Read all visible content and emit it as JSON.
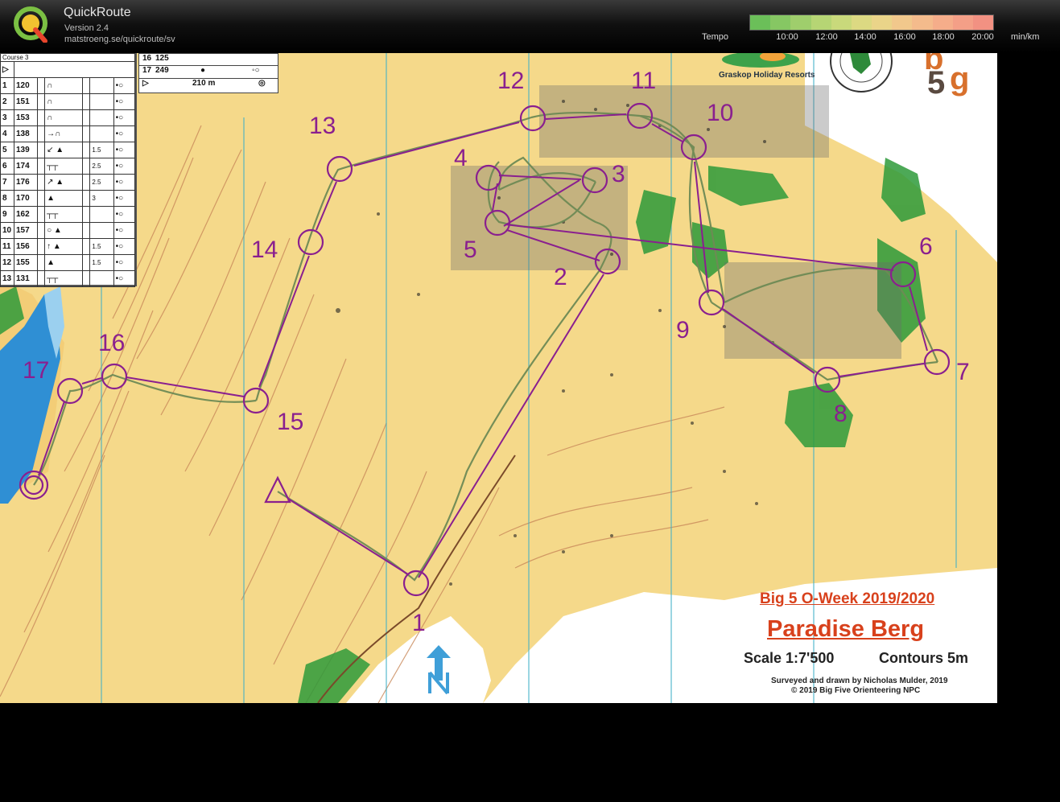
{
  "app": {
    "title": "QuickRoute",
    "version": "Version 2.4",
    "url": "matstroeng.se/quickroute/sv"
  },
  "tempo": {
    "label": "Tempo",
    "ticks": [
      "10:00",
      "12:00",
      "14:00",
      "16:00",
      "18:00",
      "20:00"
    ],
    "unit": "min/km",
    "colors": [
      "#6bbf59",
      "#86c763",
      "#9fce6c",
      "#b6d574",
      "#c9d97b",
      "#dcd982",
      "#ead489",
      "#f1c88c",
      "#f4bb8c",
      "#f5ad8a",
      "#f49f87",
      "#f29182"
    ]
  },
  "colors": {
    "course": "#8a1f8f",
    "route": "#6e8a55",
    "water": "#2f8fd4",
    "vegetation": "#2e9a3a",
    "title_orange": "#d8411c"
  },
  "legend": {
    "header": "Course 3",
    "rows": [
      {
        "n": "1",
        "code": "120"
      },
      {
        "n": "2",
        "code": "151"
      },
      {
        "n": "3",
        "code": "153"
      },
      {
        "n": "4",
        "code": "138"
      },
      {
        "n": "5",
        "code": "139",
        "dim": "1.5"
      },
      {
        "n": "6",
        "code": "174",
        "dim": "2.5"
      },
      {
        "n": "7",
        "code": "176",
        "dim": "2.5"
      },
      {
        "n": "8",
        "code": "170",
        "dim": "3"
      },
      {
        "n": "9",
        "code": "162"
      },
      {
        "n": "10",
        "code": "157"
      },
      {
        "n": "11",
        "code": "156",
        "dim": "1.5"
      },
      {
        "n": "12",
        "code": "155",
        "dim": "1.5"
      },
      {
        "n": "13",
        "code": "131"
      }
    ],
    "extra": [
      {
        "n": "16",
        "code": "125"
      },
      {
        "n": "17",
        "code": "249"
      }
    ],
    "finish": "210 m"
  },
  "map": {
    "sponsor": "Graskop Holiday Resorts",
    "event_title": "Big 5 O-Week 2019/2020",
    "map_name": "Paradise Berg",
    "scale": "Scale 1:7'500",
    "contours": "Contours 5m",
    "credit1": "Surveyed and drawn by Nicholas Mulder, 2019",
    "credit2": "© 2019 Big Five Orienteering NPC",
    "controls": [
      "1",
      "2",
      "3",
      "4",
      "5",
      "6",
      "7",
      "8",
      "9",
      "10",
      "11",
      "12",
      "13",
      "14",
      "15",
      "16",
      "17"
    ]
  }
}
